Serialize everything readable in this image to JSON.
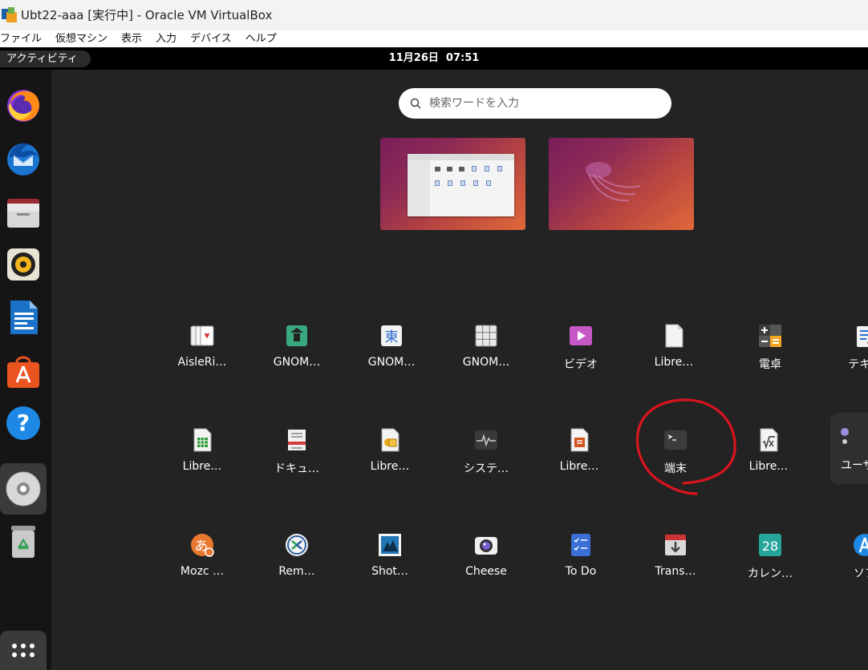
{
  "window": {
    "title": "Ubt22-aaa [実行中] - Oracle VM VirtualBox",
    "menu": [
      "ファイル",
      "仮想マシン",
      "表示",
      "入力",
      "デバイス",
      "ヘルプ"
    ]
  },
  "topbar": {
    "activities": "アクティビティ",
    "clock": "11月26日  07:51"
  },
  "search": {
    "placeholder": "検索ワードを入力"
  },
  "dock": [
    {
      "name": "firefox-icon"
    },
    {
      "name": "thunderbird-icon"
    },
    {
      "name": "files-icon"
    },
    {
      "name": "rhythmbox-icon"
    },
    {
      "name": "libreoffice-writer-icon"
    },
    {
      "name": "app-center-icon"
    },
    {
      "name": "help-icon"
    },
    {
      "name": "optical-disc-icon"
    },
    {
      "name": "trash-icon"
    },
    {
      "name": "show-apps-icon"
    }
  ],
  "apps": {
    "row1": [
      "AisleRi…",
      "GNOM…",
      "GNOM…",
      "GNOM…",
      "ビデオ",
      "Libre…",
      "電卓",
      "テキス"
    ],
    "row2": [
      "Libre…",
      "ドキュ…",
      "Libre…",
      "システ…",
      "Libre…",
      "端末",
      "Libre…",
      "ユーザ"
    ],
    "row3": [
      "Mozc …",
      "Rem…",
      "Shot…",
      "Cheese",
      "To Do",
      "Trans…",
      "カレン…",
      "ソフ"
    ]
  },
  "icons": {
    "calendar_day": "28",
    "kanji_icon_glyph": "東",
    "mozc_glyph": "あ"
  },
  "colors": {
    "annotation": "#d9141e",
    "accent": "#e95420"
  }
}
